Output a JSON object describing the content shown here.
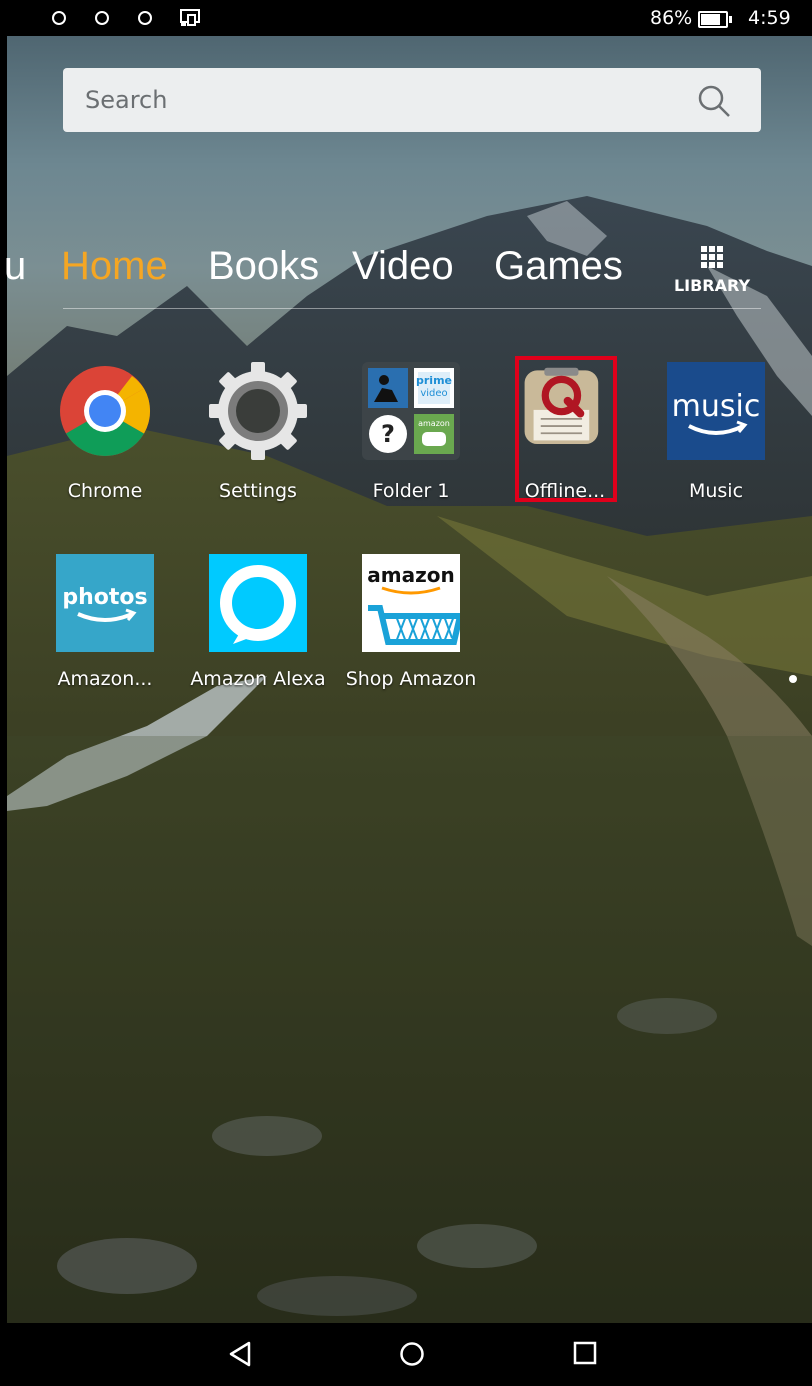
{
  "status_bar": {
    "battery": "86%",
    "time": "4:59"
  },
  "search": {
    "placeholder": "Search"
  },
  "tabs": [
    {
      "label": "u"
    },
    {
      "label": "Home"
    },
    {
      "label": "Books"
    },
    {
      "label": "Video"
    },
    {
      "label": "Games"
    }
  ],
  "library": {
    "label": "LIBRARY"
  },
  "apps": [
    {
      "label": "Chrome",
      "icon": "chrome-icon"
    },
    {
      "label": "Settings",
      "icon": "settings-gear-icon"
    },
    {
      "label": "Folder 1",
      "icon": "folder-icon"
    },
    {
      "label": "Offline...",
      "icon": "offline-q-icon"
    },
    {
      "label": "Music",
      "icon": "amazon-music-icon"
    },
    {
      "label": "Amazon...",
      "icon": "amazon-photos-icon"
    },
    {
      "label": "Amazon Alexa",
      "icon": "alexa-icon"
    },
    {
      "label": "Shop Amazon",
      "icon": "shop-amazon-icon"
    }
  ],
  "icon_text": {
    "prime": "prime",
    "video": "video",
    "amazon": "amazon",
    "music": "music",
    "photos": "photos",
    "question": "?"
  },
  "colors": {
    "active_tab": "#f5a623",
    "highlight": "#e0001b",
    "alexa_blue": "#00caff",
    "music_blue": "#1a4b8c"
  }
}
